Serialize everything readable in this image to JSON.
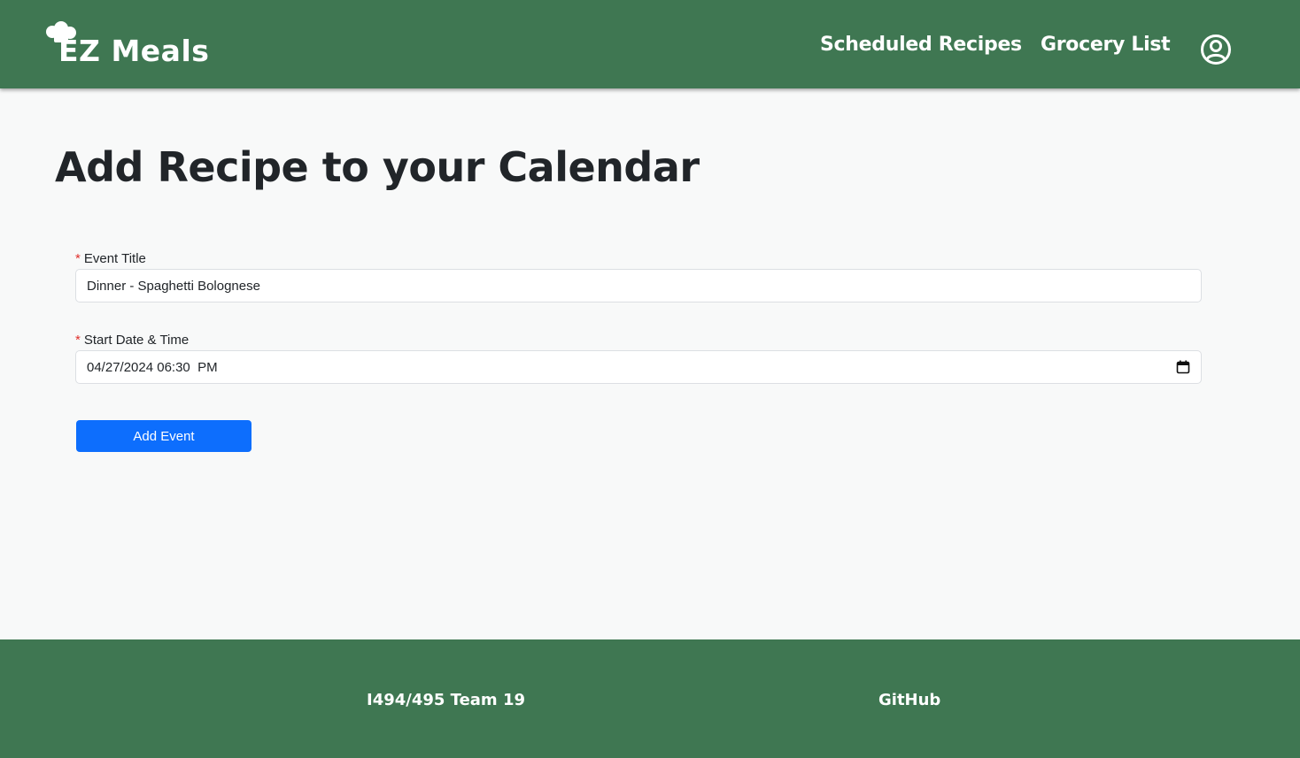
{
  "nav": {
    "brand": "EZ Meals",
    "links": [
      "Scheduled Recipes",
      "Grocery List"
    ],
    "account_icon": "user-circle-icon",
    "brand_icon": "chef-hat-icon",
    "background": "#3f7752"
  },
  "main": {
    "title": "Add Recipe to your Calendar",
    "form": {
      "required_marker": "*",
      "event_title_label": "Event Title",
      "event_title_value": "Dinner - Spaghetti Bolognese",
      "start_label": "Start Date & Time",
      "start_value": "04/27/2024 06:30  PM",
      "submit_label": "Add Event"
    }
  },
  "footer": {
    "team": "I494/495 Team 19",
    "github": "GitHub"
  },
  "colors": {
    "primary": "#0d6efd",
    "brand_green": "#3f7752",
    "required": "#e0312d"
  }
}
